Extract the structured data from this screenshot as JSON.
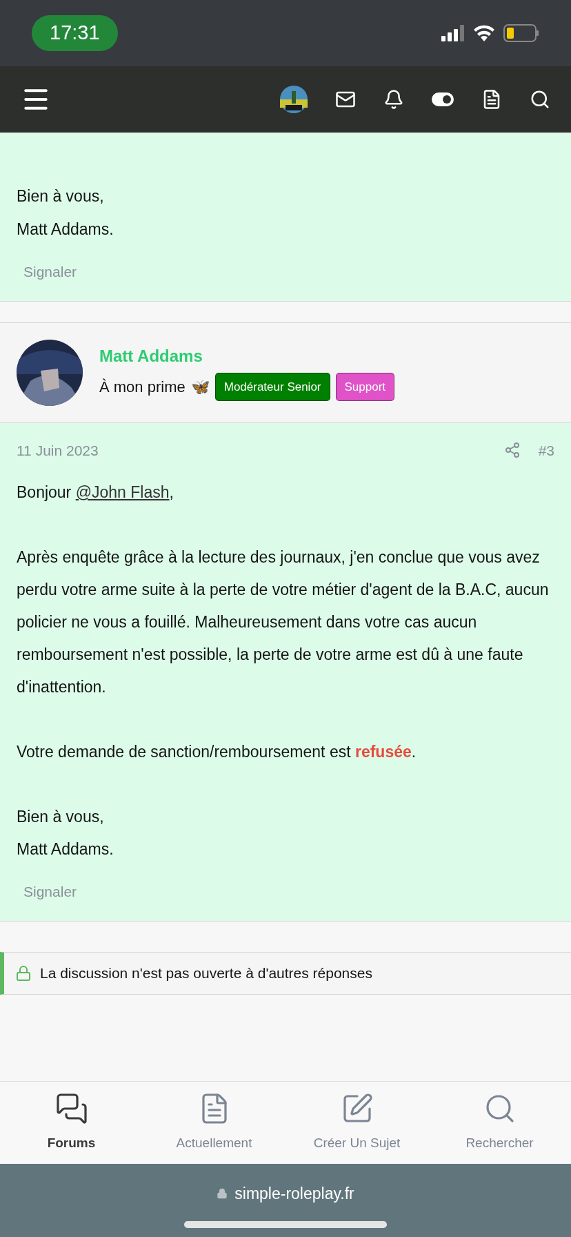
{
  "status_bar": {
    "time": "17:31"
  },
  "previous_post": {
    "lines": [
      "Bien à vous,",
      "Matt Addams."
    ],
    "report": "Signaler"
  },
  "author": {
    "name": "Matt Addams",
    "title": "À mon prime",
    "emoji": "🦋",
    "badges": [
      {
        "label": "Modérateur Senior",
        "color": "#008000"
      },
      {
        "label": "Support",
        "color": "#e052c8"
      }
    ]
  },
  "post": {
    "date": "11 Juin 2023",
    "number": "#3",
    "greeting": {
      "before": "Bonjour ",
      "mention": "@John Flash",
      "after": ","
    },
    "paragraphs": [
      "Après enquête grâce à la lecture des journaux, j'en conclue que vous avez perdu votre arme suite à la perte de votre métier d'agent de la B.A.C, aucun policier ne vous a fouillé. Malheureusement dans votre cas aucun remboursement n'est possible, la perte de votre arme est dû à une faute d'inattention.",
      "Votre demande de sanction/remboursement est **refusée**.",
      "Bien à vous,\nMatt Addams."
    ],
    "report": "Signaler"
  },
  "locked_notice": "La discussion n'est pas ouverte à d'autres réponses",
  "bottom_nav": [
    {
      "kind": "forums",
      "label": "Forums",
      "selected": true
    },
    {
      "kind": "document",
      "label": "Actuellement",
      "selected": false
    },
    {
      "kind": "edit",
      "label": "Créer Un Sujet",
      "selected": false
    },
    {
      "kind": "search",
      "label": "Rechercher",
      "selected": false
    }
  ],
  "url_bar": {
    "domain": "simple-roleplay.fr"
  }
}
